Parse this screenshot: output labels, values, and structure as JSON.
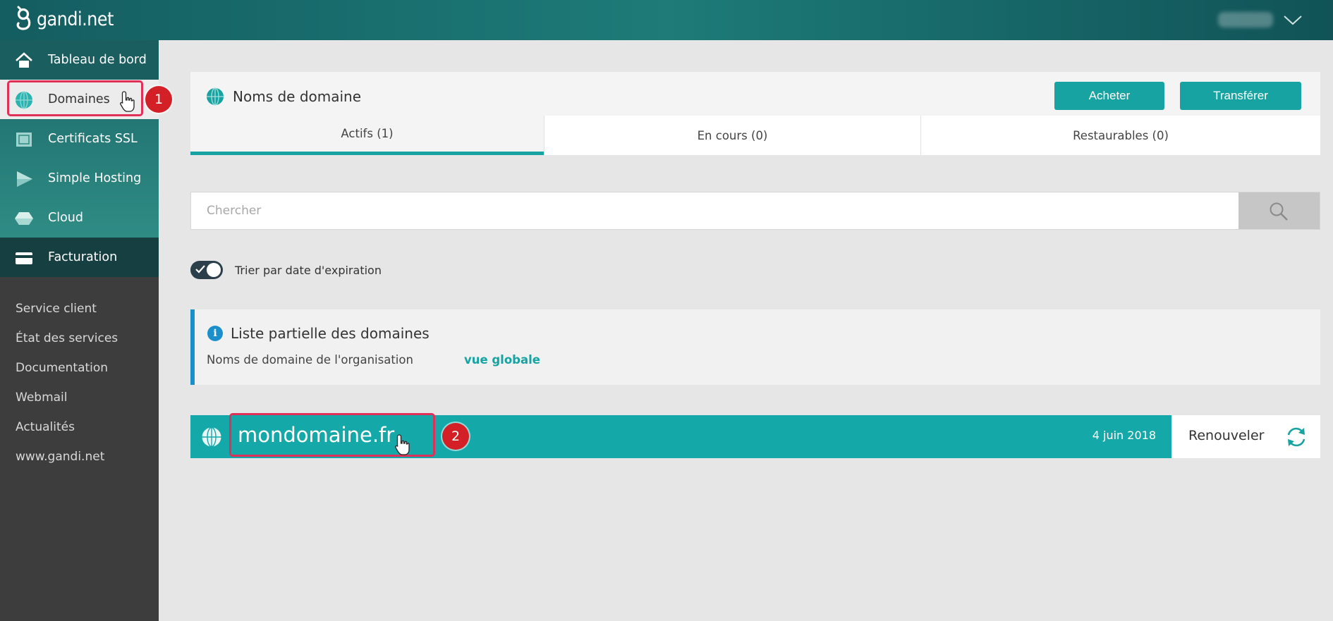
{
  "app": {
    "logo_text": "gandi.net"
  },
  "sidebar": {
    "items": [
      {
        "label": "Tableau de bord",
        "icon": "home-icon"
      },
      {
        "label": "Domaines",
        "icon": "globe-icon"
      },
      {
        "label": "Certificats SSL",
        "icon": "certificate-icon"
      },
      {
        "label": "Simple Hosting",
        "icon": "play-icon"
      },
      {
        "label": "Cloud",
        "icon": "cube-icon"
      },
      {
        "label": "Facturation",
        "icon": "card-icon"
      }
    ],
    "secondary": [
      {
        "label": "Service client"
      },
      {
        "label": "État des services"
      },
      {
        "label": "Documentation"
      },
      {
        "label": "Webmail"
      },
      {
        "label": "Actualités"
      },
      {
        "label": "www.gandi.net"
      }
    ]
  },
  "annotations": {
    "step1": "1",
    "step2": "2"
  },
  "main": {
    "title": "Noms de domaine",
    "buy_label": "Acheter",
    "transfer_label": "Transférer",
    "tabs": [
      {
        "label": "Actifs (1)",
        "active": true
      },
      {
        "label": "En cours (0)",
        "active": false
      },
      {
        "label": "Restaurables (0)",
        "active": false
      }
    ],
    "search": {
      "placeholder": "Chercher"
    },
    "sort_toggle": {
      "label": "Trier par date d'expiration",
      "on": true
    },
    "notice": {
      "title": "Liste partielle des domaines",
      "text": "Noms de domaine de l'organisation",
      "link": "vue globale"
    },
    "domains": [
      {
        "name": "mondomaine.fr",
        "expiry": "4 juin 2018",
        "renew_label": "Renouveler"
      }
    ]
  },
  "colors": {
    "accent": "#17a3a1",
    "annotation": "#e0305a",
    "badge": "#d32026",
    "info": "#1a8fcc"
  }
}
